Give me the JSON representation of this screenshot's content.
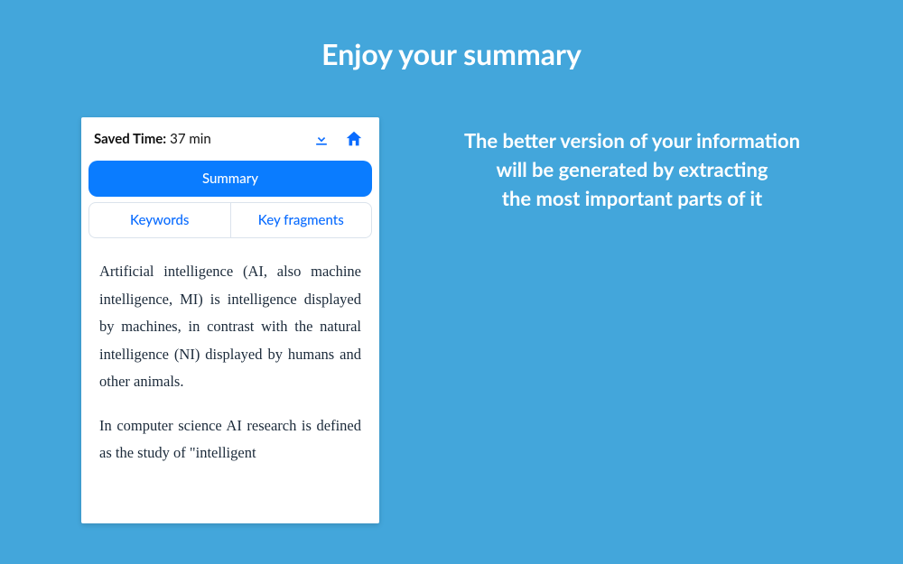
{
  "hero": {
    "title": "Enjoy your summary",
    "subtitle_line1": "The better version of your information",
    "subtitle_line2": "will be generated by extracting",
    "subtitle_line3": "the most important parts of it"
  },
  "panel": {
    "saved_label": "Saved Time:",
    "saved_value": "37 min",
    "tabs": {
      "summary": "Summary",
      "keywords": "Keywords",
      "fragments": "Key fragments"
    },
    "paragraphs": [
      "Artificial intelligence (AI, also machine intelligence, MI) is intelligence displayed by machines, in contrast with the natural intelligence (NI) displayed by humans and other animals.",
      "In computer science AI research is defined as the study of \"intelligent"
    ]
  },
  "icons": {
    "download": "download-icon",
    "home": "home-icon"
  },
  "colors": {
    "bg": "#43a6db",
    "accent": "#0a7cff"
  }
}
